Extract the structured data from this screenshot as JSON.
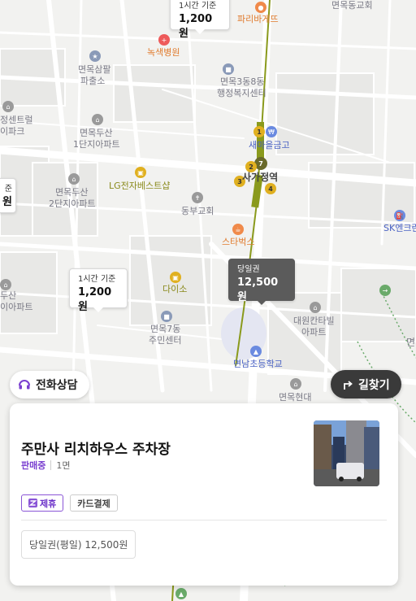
{
  "map": {
    "labels": {
      "p1": "파리바게뜨",
      "p2": "면목동교회",
      "p3": "녹색병원",
      "p4": "면목삼팔",
      "p4b": "파출소",
      "p5": "면목3동8동",
      "p5b": "행정복지센터",
      "p6": "정센트럴",
      "p6b": "이파크",
      "p7": "면목두산",
      "p7b": "1단지아파트",
      "p8": "새마을금고",
      "p9": "사가정역",
      "p10": "LG전자베스트샵",
      "p11": "면목두산",
      "p11b": "2단지아파트",
      "p12": "동부교회",
      "p13": "SK엔크린",
      "p14": "스타벅스",
      "p15": "다이소",
      "p16": "두산",
      "p16b": "이아파트",
      "p17": "면목7동",
      "p17b": "주민센터",
      "p18": "대원칸타빌",
      "p18b": "아파트",
      "p19": "면남초등학교",
      "p20": "면목현대",
      "p21": "스",
      "p22": "면"
    },
    "pins": [
      {
        "small": "1시간 기준",
        "big": "1,200원"
      },
      {
        "small": "준",
        "big": "원"
      },
      {
        "small": "1시간 기준",
        "big": "1,200원"
      },
      {
        "small": "당일권",
        "big": "12,500원"
      }
    ],
    "subway_lines": [
      "1",
      "7",
      "2",
      "3",
      "4"
    ]
  },
  "buttons": {
    "consult_label": "전화상담",
    "route_label": "길찾기"
  },
  "card": {
    "title": "주만사 리치하우스 주차장",
    "status": "판매중",
    "spaces": "1면",
    "tags": {
      "partner": "제휴",
      "card": "카드결제"
    },
    "price": "당일권(평일) 12,500원"
  },
  "colors": {
    "accent_purple": "#7a3fd0",
    "pin_dark": "#5b5b5b",
    "subway_green": "#8a9a1c"
  },
  "icons": {
    "consult": "headset-icon",
    "route": "turn-right-arrow-icon",
    "partner": "z-logo-icon"
  }
}
